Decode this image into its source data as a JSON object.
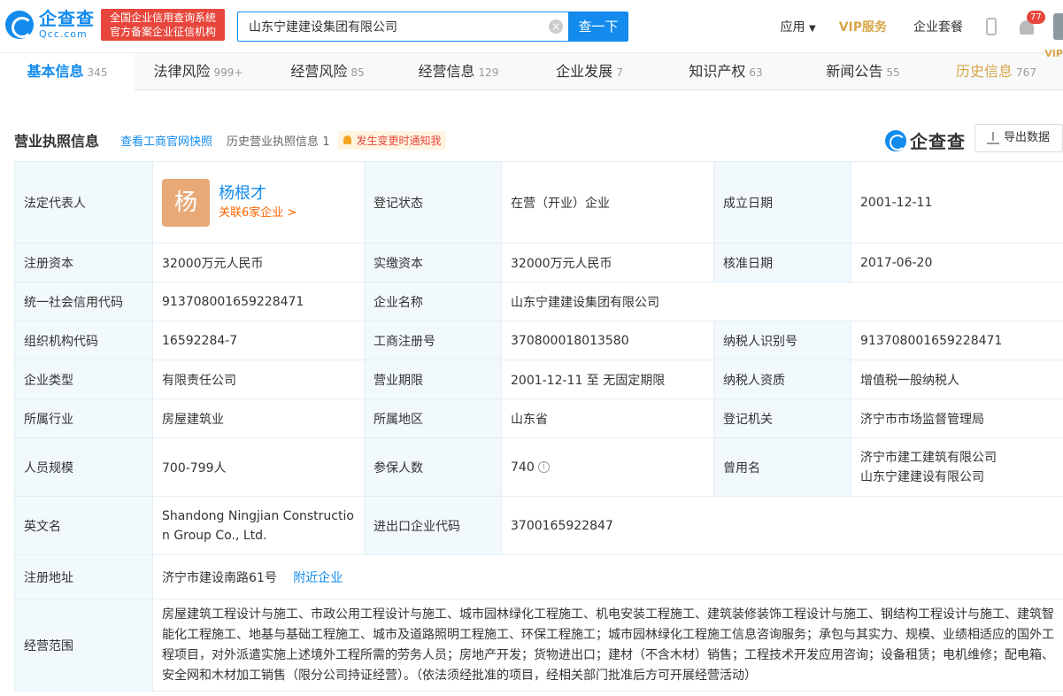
{
  "header": {
    "logo_cn": "企查查",
    "logo_en": "Qcc.com",
    "badge_line1": "全国企业信用查询系统",
    "badge_line2": "官方备案企业征信机构",
    "search_value": "山东宁建建设集团有限公司",
    "search_button": "查一下",
    "nav_apps": "应用",
    "nav_vip": "VIP服务",
    "nav_package": "企业套餐",
    "notif_count": "77"
  },
  "tabs": [
    {
      "label": "基本信息",
      "count": "345"
    },
    {
      "label": "法律风险",
      "count": "999+"
    },
    {
      "label": "经营风险",
      "count": "85"
    },
    {
      "label": "经营信息",
      "count": "129"
    },
    {
      "label": "企业发展",
      "count": "7"
    },
    {
      "label": "知识产权",
      "count": "63"
    },
    {
      "label": "新闻公告",
      "count": "55"
    },
    {
      "label": "历史信息",
      "count": "767",
      "tag": "VIP"
    }
  ],
  "section": {
    "title": "营业执照信息",
    "snapshot_link": "查看工商官网快照",
    "history_label": "历史营业执照信息",
    "history_count": "1",
    "notify": "发生变更时通知我",
    "brand": "企查查",
    "export": "导出数据"
  },
  "info": {
    "legal_rep_label": "法定代表人",
    "legal_rep_avatar": "杨",
    "legal_rep_name": "杨根才",
    "legal_rep_related": "关联6家企业 >",
    "reg_status_label": "登记状态",
    "reg_status": "在营（开业）企业",
    "founded_label": "成立日期",
    "founded": "2001-12-11",
    "reg_capital_label": "注册资本",
    "reg_capital": "32000万元人民币",
    "paid_capital_label": "实缴资本",
    "paid_capital": "32000万元人民币",
    "approval_date_label": "核准日期",
    "approval_date": "2017-06-20",
    "credit_code_label": "统一社会信用代码",
    "credit_code": "913708001659228471",
    "company_name_label": "企业名称",
    "company_name": "山东宁建建设集团有限公司",
    "org_code_label": "组织机构代码",
    "org_code": "16592284-7",
    "reg_number_label": "工商注册号",
    "reg_number": "370800018013580",
    "taxpayer_id_label": "纳税人识别号",
    "taxpayer_id": "913708001659228471",
    "company_type_label": "企业类型",
    "company_type": "有限责任公司",
    "term_label": "营业期限",
    "term": "2001-12-11 至 无固定期限",
    "taxpayer_qual_label": "纳税人资质",
    "taxpayer_qual": "增值税一般纳税人",
    "industry_label": "所属行业",
    "industry": "房屋建筑业",
    "region_label": "所属地区",
    "region": "山东省",
    "authority_label": "登记机关",
    "authority": "济宁市市场监督管理局",
    "staff_size_label": "人员规模",
    "staff_size": "700-799人",
    "insured_label": "参保人数",
    "insured": "740",
    "former_names_label": "曾用名",
    "former_name_1": "济宁市建工建筑有限公司",
    "former_name_2": "山东宁建建设有限公司",
    "english_name_label": "英文名",
    "english_name_1": "Shandong Ningjian Constructio",
    "english_name_2": "n Group Co., Ltd.",
    "import_export_label": "进出口企业代码",
    "import_export": "3700165922847",
    "address_label": "注册地址",
    "address": "济宁市建设南路61号",
    "nearby_link": "附近企业",
    "scope_label": "经营范围",
    "scope_1": "房屋建筑工程设计与施工、市政公用工程设计与施工、城市园林绿化工程施工、机电安装工程施工、建筑装修装饰工程设计与施工、钢结构工程设计与施工、建筑智",
    "scope_2": "能化工程施工、地基与基础工程施工、城市及道路照明工程施工、环保工程施工；城市园林绿化工程施工信息咨询服务；承包与其实力、规模、业绩相适应的国外工",
    "scope_3": "程项目，对外派遣实施上述境外工程所需的劳务人员；房地产开发；货物进出口；建材（不含木材）销售；工程技术开发应用咨询；设备租赁；电机维修；配电箱、",
    "scope_4": "安全网和木材加工销售（限分公司持证经营）。（依法须经批准的项目，经相关部门批准后方可开展经营活动）"
  }
}
